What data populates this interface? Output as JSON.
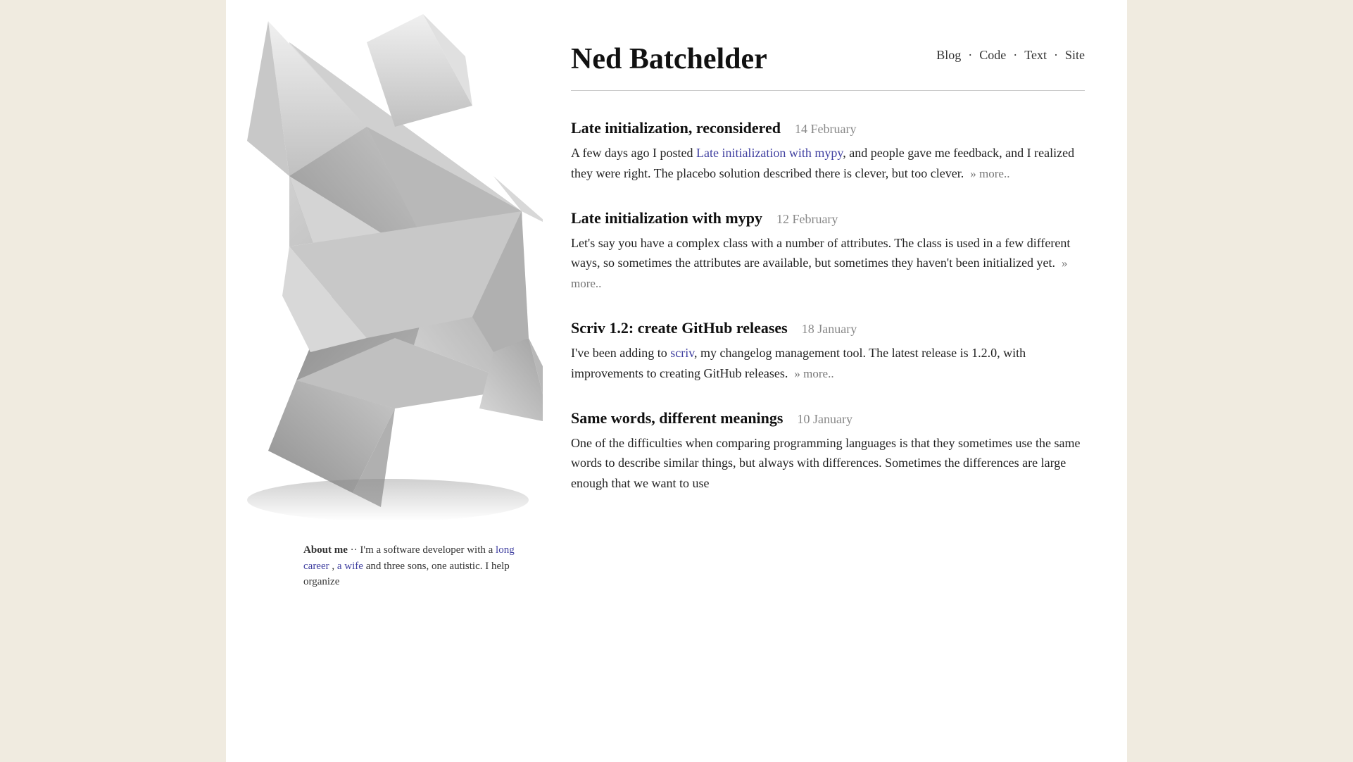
{
  "page": {
    "background_color": "#f0ebe0"
  },
  "header": {
    "site_title": "Ned Batchelder",
    "nav": {
      "items": [
        {
          "label": "Blog",
          "href": "#"
        },
        {
          "label": "Code",
          "href": "#"
        },
        {
          "label": "Text",
          "href": "#"
        },
        {
          "label": "Site",
          "href": "#"
        }
      ],
      "separator": "·"
    }
  },
  "posts": [
    {
      "title": "Late initialization, reconsidered",
      "date": "14 February",
      "excerpt_parts": [
        {
          "type": "text",
          "content": "A few days ago I posted "
        },
        {
          "type": "link",
          "content": "Late initialization with mypy",
          "href": "#"
        },
        {
          "type": "text",
          "content": ", and people gave me feedback, and I realized they were right. The placebo solution described there is clever, but too clever."
        }
      ],
      "read_more": "» more.."
    },
    {
      "title": "Late initialization with mypy",
      "date": "12 February",
      "excerpt_parts": [
        {
          "type": "text",
          "content": "Let's say you have a complex class with a number of attributes. The class is used in a few different ways, so sometimes the attributes are available, but sometimes they haven't been initialized yet."
        }
      ],
      "read_more": "» more.."
    },
    {
      "title": "Scriv 1.2: create GitHub releases",
      "date": "18 January",
      "excerpt_parts": [
        {
          "type": "text",
          "content": "I've been adding to "
        },
        {
          "type": "link",
          "content": "scriv",
          "href": "#"
        },
        {
          "type": "text",
          "content": ", my changelog management tool. The latest release is 1.2.0, with improvements to creating GitHub releases."
        }
      ],
      "read_more": "» more.."
    },
    {
      "title": "Same words, different meanings",
      "date": "10 January",
      "excerpt_parts": [
        {
          "type": "text",
          "content": "One of the difficulties when comparing programming languages is that they sometimes use the same words to describe similar things, but always with differences. Sometimes the differences are large enough that we want to use"
        }
      ],
      "read_more": ""
    }
  ],
  "about": {
    "label": "About me",
    "text_parts": [
      {
        "type": "text",
        "content": " ·· I'm a software developer with a "
      },
      {
        "type": "link",
        "content": "long career",
        "href": "#"
      },
      {
        "type": "text",
        "content": ", "
      },
      {
        "type": "link",
        "content": "a wife",
        "href": "#"
      },
      {
        "type": "text",
        "content": " and three sons, one autistic. I help organize"
      }
    ]
  }
}
